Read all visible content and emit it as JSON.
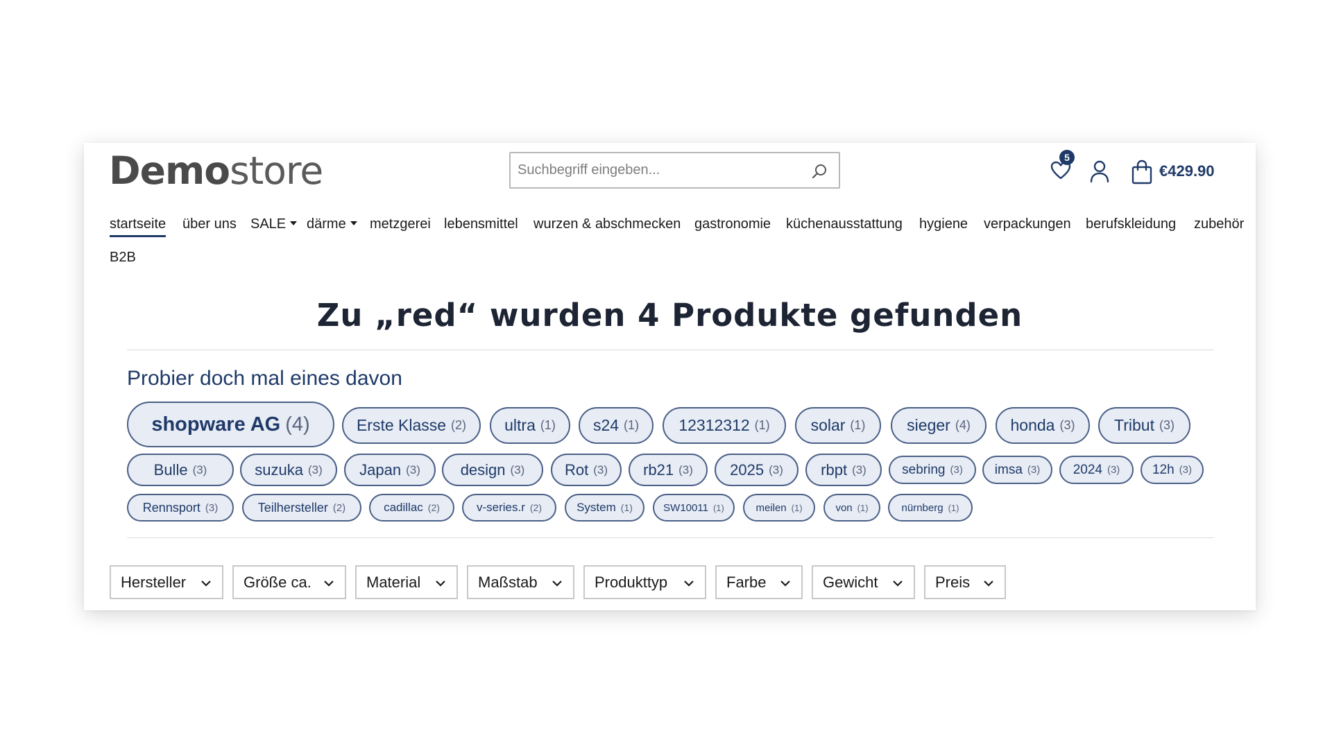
{
  "header": {
    "logo_bold": "Demo",
    "logo_light": "store",
    "search_placeholder": "Suchbegriff eingeben...",
    "wishlist_count": "5",
    "cart_total": "€429.90"
  },
  "nav": {
    "items": [
      {
        "label": "startseite",
        "active": true,
        "dropdown": false
      },
      {
        "label": "über uns",
        "active": false,
        "dropdown": false
      },
      {
        "label": "SALE",
        "active": false,
        "dropdown": true
      },
      {
        "label": "därme",
        "active": false,
        "dropdown": true
      },
      {
        "label": "metzgerei",
        "active": false,
        "dropdown": false
      },
      {
        "label": "lebensmittel",
        "active": false,
        "dropdown": false
      },
      {
        "label": "wurzen & abschmecken",
        "active": false,
        "dropdown": false
      },
      {
        "label": "gastronomie",
        "active": false,
        "dropdown": false
      },
      {
        "label": "küchenausstattung",
        "active": false,
        "dropdown": false
      },
      {
        "label": "hygiene",
        "active": false,
        "dropdown": false
      },
      {
        "label": "verpackungen",
        "active": false,
        "dropdown": false
      },
      {
        "label": "berufskleidung",
        "active": false,
        "dropdown": false
      },
      {
        "label": "zubehör",
        "active": false,
        "dropdown": false
      },
      {
        "label": "B2B",
        "active": false,
        "dropdown": false
      }
    ]
  },
  "results": {
    "headline": "Zu „red“ wurden 4 Produkte gefunden",
    "suggest_title": "Probier doch mal eines davon"
  },
  "tags": [
    {
      "label": "shopware AG",
      "count": "(4)"
    },
    {
      "label": "Erste Klasse",
      "count": "(2)"
    },
    {
      "label": "ultra",
      "count": "(1)"
    },
    {
      "label": "s24",
      "count": "(1)"
    },
    {
      "label": "12312312",
      "count": "(1)"
    },
    {
      "label": "solar",
      "count": "(1)"
    },
    {
      "label": "sieger",
      "count": "(4)"
    },
    {
      "label": "honda",
      "count": "(3)"
    },
    {
      "label": "Tribut",
      "count": "(3)"
    },
    {
      "label": "Bulle",
      "count": "(3)"
    },
    {
      "label": "suzuka",
      "count": "(3)"
    },
    {
      "label": "Japan",
      "count": "(3)"
    },
    {
      "label": "design",
      "count": "(3)"
    },
    {
      "label": "Rot",
      "count": "(3)"
    },
    {
      "label": "rb21",
      "count": "(3)"
    },
    {
      "label": "2025",
      "count": "(3)"
    },
    {
      "label": "rbpt",
      "count": "(3)"
    },
    {
      "label": "sebring",
      "count": "(3)"
    },
    {
      "label": "imsa",
      "count": "(3)"
    },
    {
      "label": "2024",
      "count": "(3)"
    },
    {
      "label": "12h",
      "count": "(3)"
    },
    {
      "label": "Rennsport",
      "count": "(3)"
    },
    {
      "label": "Teilhersteller",
      "count": "(2)"
    },
    {
      "label": "cadillac",
      "count": "(2)"
    },
    {
      "label": "v-series.r",
      "count": "(2)"
    },
    {
      "label": "System",
      "count": "(1)"
    },
    {
      "label": "SW10011",
      "count": "(1)"
    },
    {
      "label": "meilen",
      "count": "(1)"
    },
    {
      "label": "von",
      "count": "(1)"
    },
    {
      "label": "nürnberg",
      "count": "(1)"
    }
  ],
  "filters": [
    "Hersteller",
    "Größe ca.",
    "Material",
    "Maßstab",
    "Produkttyp",
    "Farbe",
    "Gewicht",
    "Preis"
  ],
  "icons": {
    "search": "search-icon",
    "wishlist": "heart-icon",
    "account": "user-icon",
    "cart": "shopping-bag-icon",
    "filter_chevron": "chevron-down-icon"
  },
  "colors": {
    "accent": "#1f3a68",
    "tag_bg": "#e7ecf5",
    "tag_border": "#4a5f86"
  }
}
